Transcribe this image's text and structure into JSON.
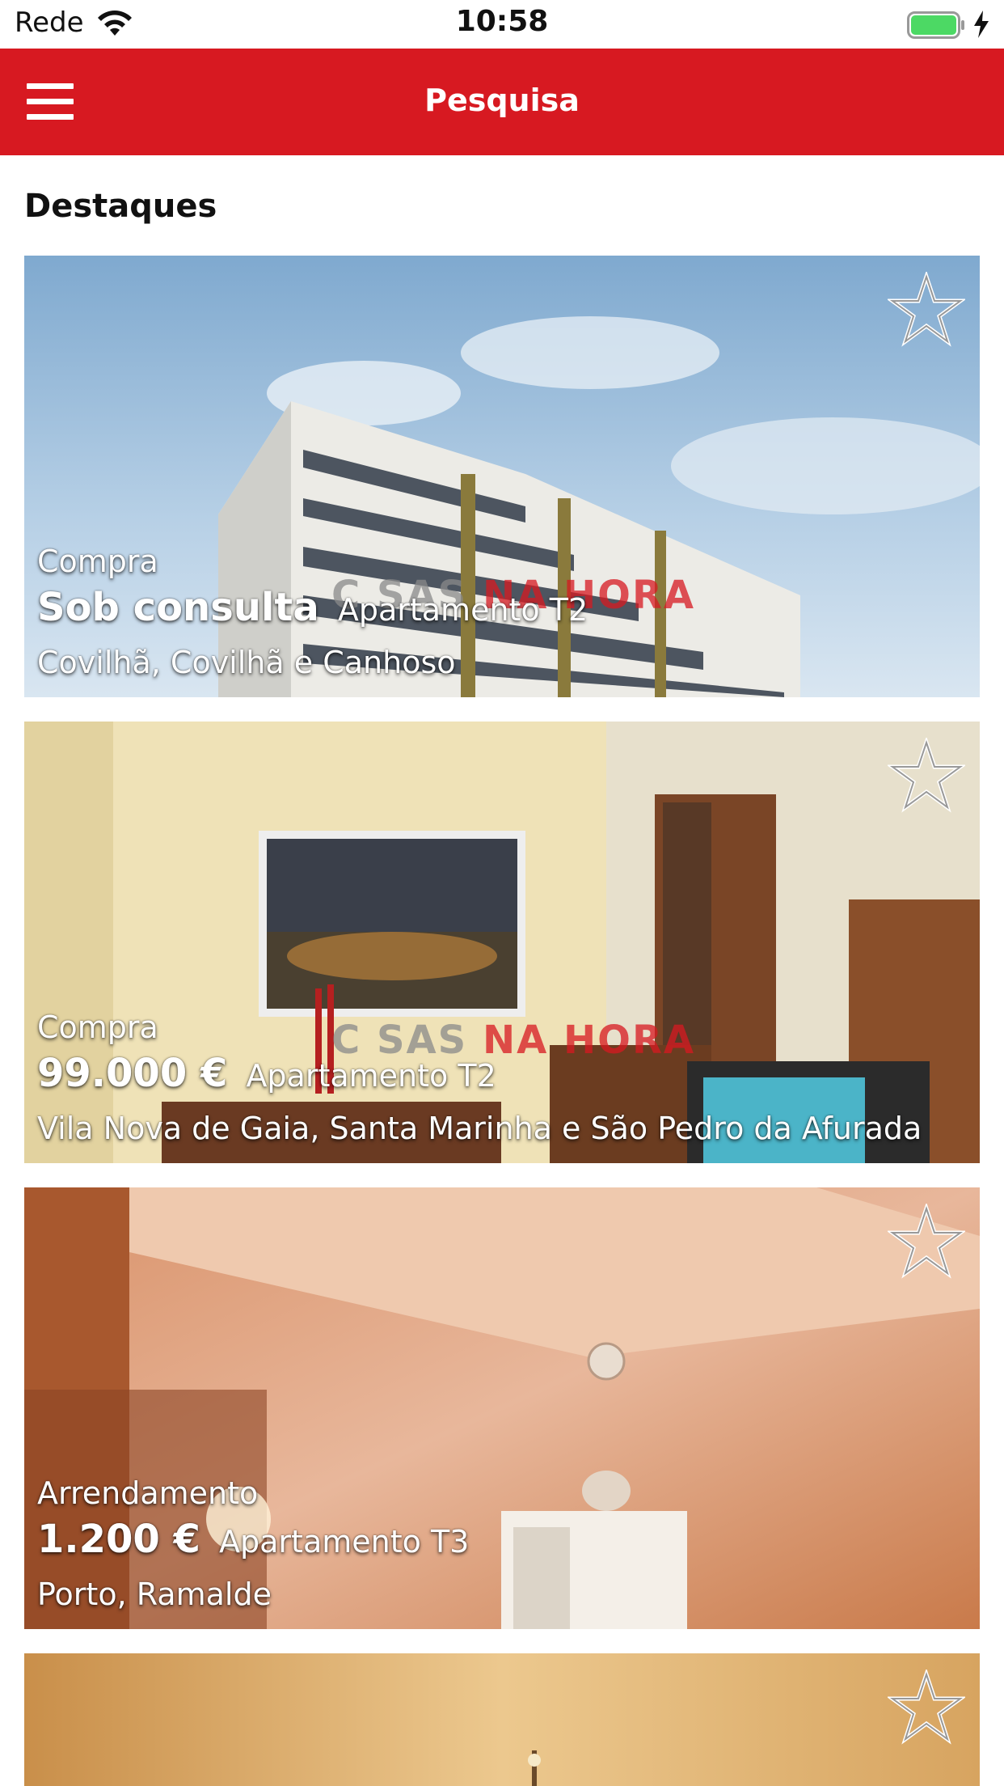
{
  "status_bar": {
    "carrier": "Rede",
    "time": "10:58"
  },
  "navbar": {
    "title": "Pesquisa",
    "menu_icon": "hamburger-menu-icon"
  },
  "section": {
    "title": "Destaques"
  },
  "watermark": {
    "part1": "C SAS",
    "part2": "NA HORA"
  },
  "listings": [
    {
      "type": "Compra",
      "price": "Sob consulta",
      "kind": "Apartamento T2",
      "location": "Covilhã, Covilhã e Canhoso"
    },
    {
      "type": "Compra",
      "price": "99.000 €",
      "kind": "Apartamento T2",
      "location": "Vila Nova de Gaia, Santa Marinha e São Pedro da Afurada"
    },
    {
      "type": "Arrendamento",
      "price": "1.200 €",
      "kind": "Apartamento T3",
      "location": "Porto, Ramalde"
    }
  ],
  "colors": {
    "brand": "#d71921",
    "battery": "#4cd964"
  }
}
